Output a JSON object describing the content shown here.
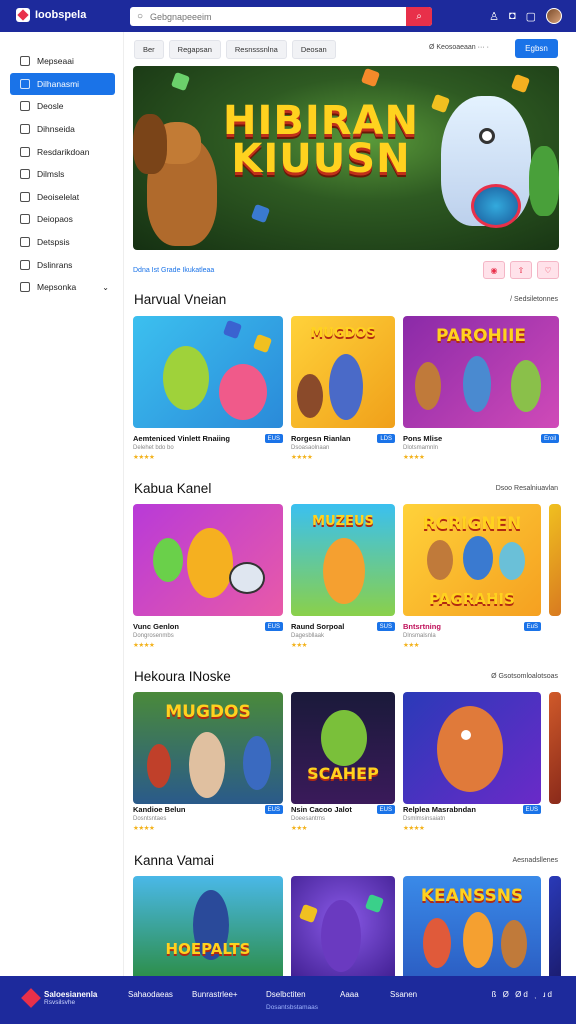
{
  "header": {
    "logo_text": "Ioobspela",
    "search_placeholder": "Gebgnapeeeim",
    "icons": [
      "search-icon",
      "bell-icon",
      "settings-icon",
      "user-avatar"
    ]
  },
  "sidebar": {
    "items": [
      {
        "label": "Mepseaai"
      },
      {
        "label": "Dilhanasmi",
        "active": true
      },
      {
        "label": "Deosle"
      },
      {
        "label": "Dihnseida"
      },
      {
        "label": "Resdarikdoan"
      },
      {
        "label": "Dilmsls"
      },
      {
        "label": "Deoiselelat"
      },
      {
        "label": "Deiopaos"
      },
      {
        "label": "Detspsis"
      },
      {
        "label": "Dslinrans"
      },
      {
        "label": "Mepsonka"
      }
    ]
  },
  "filters": {
    "chips": [
      "Ber",
      "Regapsan",
      "Resnsssnlna",
      "Deosan"
    ],
    "sort_label": "Ø Keosoaeaan ··· ·",
    "action_button": "Egbsn"
  },
  "hero": {
    "title_line1": "HIBIRAN",
    "title_line2": "KIUUSN",
    "meta": "Ddna Ist Grade  Ikukatleaa"
  },
  "sections": [
    {
      "title": "Harvual Vneian",
      "see_all": "/ Sedsiletonnes",
      "cards": [
        {
          "title": "Aemteniced Vinlett Rnaiing",
          "badge": "EUS",
          "sub": "Delehet bdo bo",
          "stars": "★★★★"
        },
        {
          "title": "Rorgesn Rianlan",
          "badge": "LDS",
          "sub": "Dsoasaolnaan",
          "stars": "★★★★"
        },
        {
          "title": "Pons Mlise",
          "badge": "Eroil",
          "sub": "Dlotsmamnln",
          "stars": "★★★★"
        }
      ]
    },
    {
      "title": "Kabua Kanel",
      "see_all": "Dsoo Resalniuavlan",
      "cards": [
        {
          "title": "Vunc Genlon",
          "badge": "EUS",
          "sub": "Dongrosenmbs",
          "stars": "★★★★"
        },
        {
          "title": "Raund Sorpoal",
          "badge": "SUS",
          "sub": "Dagesbllaak",
          "stars": "★★★"
        },
        {
          "title": "Bntsrtning",
          "badge": "EuS",
          "sub": "Dlnsmalsnla",
          "stars": "★★★"
        }
      ]
    },
    {
      "title": "Hekoura INoske",
      "see_all": "Ø Gsotsomloalotsoas",
      "cards": [
        {
          "title": "Kandioe Belun",
          "badge": "EUS",
          "sub": "Dosntsntaes",
          "stars": "★★★★"
        },
        {
          "title": "Nsin Cacoo Jalot",
          "badge": "EUS",
          "sub": "Doeesantrns",
          "stars": "★★★"
        },
        {
          "title": "Relplea Masrabndan",
          "badge": "EUS",
          "sub": "Dsmlmsinsaiatn",
          "stars": "★★★★"
        }
      ]
    },
    {
      "title": "Kanna Vamai",
      "see_all": "Aesnadsllenes",
      "cards": [
        {
          "title": "",
          "badge": "",
          "sub": "",
          "stars": ""
        },
        {
          "title": "",
          "badge": "",
          "sub": "",
          "stars": ""
        },
        {
          "title": "",
          "badge": "",
          "sub": "",
          "stars": ""
        }
      ]
    }
  ],
  "card_art": [
    "MUGDOS",
    "SCAHEP",
    "KEANSSNS",
    "MUZEUS",
    "RCRIGNEN",
    "PAGRAHIS",
    "PAROHIIE",
    "HOEPALTS"
  ],
  "footer": {
    "logo_text": "Saloesianenla",
    "logo_sub": "Rsvsilsvhe",
    "links": [
      "Sahaodaeas",
      "Bunrastrlee+",
      "Dselbctiten",
      "Aaaa",
      "Ssanen"
    ],
    "sub_text": "Dosantsbstamaas",
    "social": "ß Ø Ød ͺ ɹd"
  }
}
